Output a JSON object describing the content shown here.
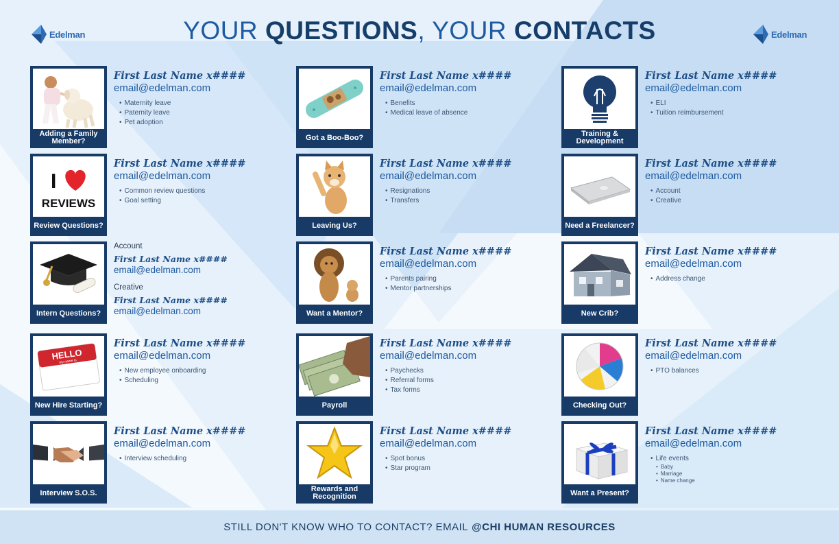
{
  "header": {
    "title_part1": "YOUR ",
    "title_part2": "QUESTIONS",
    "title_part3": ", YOUR ",
    "title_part4": "CONTACTS",
    "logo_left": "Edelman",
    "logo_right": "Edelman"
  },
  "colors": {
    "navy": "#173a66",
    "brand_blue": "#1d5aa0",
    "background": "#e6f1fb"
  },
  "cards": [
    {
      "caption": "Adding a Family Member?",
      "icon": "baby-puppy-photo-icon",
      "name": "First Last Name",
      "ext": "x####",
      "email": "email@edelman.com",
      "bullets": [
        "Maternity leave",
        "Paternity leave",
        "Pet adoption"
      ]
    },
    {
      "caption": "Review Questions?",
      "icon": "i-love-reviews-icon",
      "name": "First Last Name",
      "ext": "x####",
      "email": "email@edelman.com",
      "bullets": [
        "Common review questions",
        "Goal setting"
      ],
      "logo_i": "I",
      "logo_word": "REVIEWS"
    },
    {
      "caption": "Intern Questions?",
      "icon": "graduation-cap-icon",
      "account_label": "Account",
      "account_name": "First Last Name",
      "account_ext": "x####",
      "account_email": "email@edelman.com",
      "creative_label": "Creative",
      "creative_name": "First Last Name",
      "creative_ext": "x####",
      "creative_email": "email@edelman.com"
    },
    {
      "caption": "New Hire Starting?",
      "icon": "hello-name-tag-icon",
      "name": "First Last Name",
      "ext": "x####",
      "email": "email@edelman.com",
      "bullets": [
        "New employee onboarding",
        "Scheduling"
      ],
      "tag_hello": "HELLO",
      "tag_sub": "my name is"
    },
    {
      "caption": "Interview S.O.S.",
      "icon": "handshake-icon",
      "name": "First Last Name",
      "ext": "x####",
      "email": "email@edelman.com",
      "bullets": [
        "Interview scheduling"
      ]
    },
    {
      "caption": "Got a Boo-Boo?",
      "icon": "bandage-icon",
      "name": "First Last Name",
      "ext": "x####",
      "email": "email@edelman.com",
      "bullets": [
        "Benefits",
        "Medical leave of absence"
      ]
    },
    {
      "caption": "Leaving Us?",
      "icon": "waving-kitten-icon",
      "name": "First Last Name",
      "ext": "x####",
      "email": "email@edelman.com",
      "bullets": [
        "Resignations",
        "Transfers"
      ]
    },
    {
      "caption": "Want a Mentor?",
      "icon": "lion-and-cub-icon",
      "name": "First Last Name",
      "ext": "x####",
      "email": "email@edelman.com",
      "bullets": [
        "Parents pairing",
        "Mentor partnerships"
      ]
    },
    {
      "caption": "Payroll",
      "icon": "cash-in-hand-icon",
      "name": "First Last Name",
      "ext": "x####",
      "email": "email@edelman.com",
      "bullets": [
        "Paychecks",
        "Referral forms",
        "Tax forms"
      ]
    },
    {
      "caption": "Rewards and Recognition",
      "icon": "gold-star-icon",
      "name": "First Last Name",
      "ext": "x####",
      "email": "email@edelman.com",
      "bullets": [
        "Spot bonus",
        "Star program"
      ]
    },
    {
      "caption": "Training & Development",
      "icon": "lightbulb-icon",
      "name": "First Last Name",
      "ext": "x####",
      "email": "email@edelman.com",
      "bullets": [
        "ELI",
        "Tuition reimbursement"
      ]
    },
    {
      "caption": "Need a Freelancer?",
      "icon": "laptop-icon",
      "name": "First Last Name",
      "ext": "x####",
      "email": "email@edelman.com",
      "bullets": [
        "Account",
        "Creative"
      ]
    },
    {
      "caption": "New Crib?",
      "icon": "house-icon",
      "name": "First Last Name",
      "ext": "x####",
      "email": "email@edelman.com",
      "bullets": [
        "Address change"
      ]
    },
    {
      "caption": "Checking Out?",
      "icon": "beach-ball-icon",
      "name": "First Last Name",
      "ext": "x####",
      "email": "email@edelman.com",
      "bullets": [
        "PTO balances"
      ]
    },
    {
      "caption": "Want a Present?",
      "icon": "gift-box-icon",
      "name": "First Last Name",
      "ext": "x####",
      "email": "email@edelman.com",
      "bullets": [
        "Life events"
      ],
      "sub_bullets": [
        "Baby",
        "Marriage",
        "Name change"
      ]
    }
  ],
  "footer": {
    "text": "STILL DON'T KNOW WHO TO CONTACT? EMAIL",
    "bold": "@CHI HUMAN RESOURCES"
  }
}
